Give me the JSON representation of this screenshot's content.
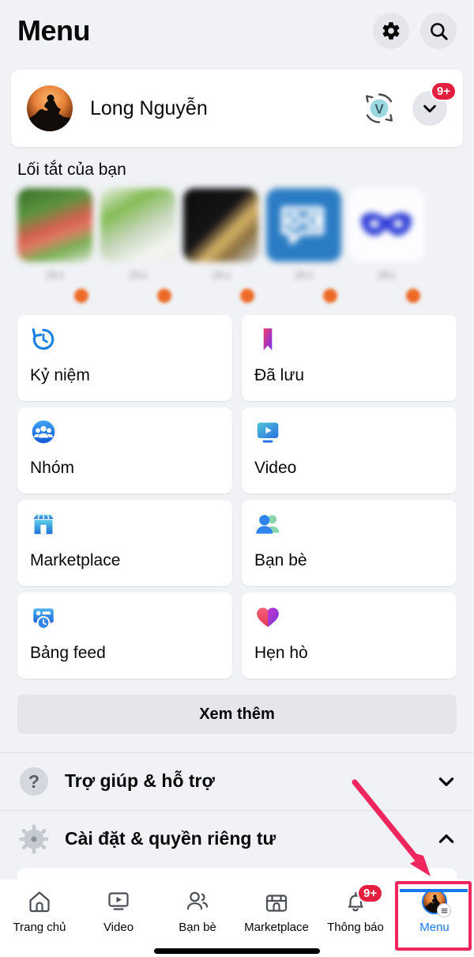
{
  "header": {
    "title": "Menu",
    "settings_icon": "gear-icon",
    "search_icon": "search-icon"
  },
  "profile": {
    "name": "Long Nguyễn",
    "avatar_icon": "user-avatar",
    "switch_account_icon": "avatar-switch-icon",
    "switch_account_letter": "V",
    "expand_icon": "chevron-down-icon",
    "notification_badge": "9+"
  },
  "shortcuts": {
    "title": "Lối tắt của bạn",
    "items": [
      {
        "label": "(ẩn)",
        "thumb": "photo-thumbnail-red-fruit",
        "colors": [
          "#3c6b2a",
          "#d96a5a",
          "#8fbf5f"
        ],
        "badge": "orange-dot-badge"
      },
      {
        "label": "(ẩn)",
        "thumb": "photo-thumbnail-green-plant",
        "colors": [
          "#f2f4f0",
          "#7fb84f",
          "#c9d3c0"
        ],
        "badge": "orange-dot-badge"
      },
      {
        "label": "(ẩn)",
        "thumb": "photo-thumbnail-dark-person",
        "colors": [
          "#141414",
          "#d9b468",
          "#3a3a3a"
        ],
        "badge": "orange-dot-badge"
      },
      {
        "label": "(ẩn)",
        "thumb": "app-icon-blue-page",
        "colors": [
          "#2b7cc4",
          "#2b7cc4",
          "#2b7cc4"
        ],
        "badge": "orange-dot-badge"
      },
      {
        "label": "(ẩn)",
        "thumb": "app-icon-blue-mask",
        "colors": [
          "#ffffff",
          "#2f3ed6",
          "#ffffff"
        ],
        "badge": "orange-dot-badge"
      }
    ]
  },
  "menu_grid": [
    {
      "label": "Kỷ niệm",
      "icon": "memories-clock-icon"
    },
    {
      "label": "Đã lưu",
      "icon": "saved-bookmark-icon"
    },
    {
      "label": "Nhóm",
      "icon": "groups-icon"
    },
    {
      "label": "Video",
      "icon": "video-icon"
    },
    {
      "label": "Marketplace",
      "icon": "marketplace-store-icon"
    },
    {
      "label": "Bạn bè",
      "icon": "friends-icon"
    },
    {
      "label": "Bảng feed",
      "icon": "feeds-icon"
    },
    {
      "label": "Hẹn hò",
      "icon": "dating-heart-icon"
    }
  ],
  "see_more": {
    "label": "Xem thêm"
  },
  "expanders": [
    {
      "label": "Trợ giúp & hỗ trợ",
      "icon": "help-question-icon",
      "chevron": "chevron-down-icon",
      "expanded": "false"
    },
    {
      "label": "Cài đặt & quyền riêng tư",
      "icon": "settings-gear-icon",
      "chevron": "chevron-up-icon",
      "expanded": "true"
    }
  ],
  "bottom_nav": [
    {
      "label": "Trang chủ",
      "icon": "home-icon",
      "active": "false",
      "badge": ""
    },
    {
      "label": "Video",
      "icon": "video-icon",
      "active": "false",
      "badge": ""
    },
    {
      "label": "Bạn bè",
      "icon": "friends-icon",
      "active": "false",
      "badge": ""
    },
    {
      "label": "Marketplace",
      "icon": "marketplace-icon",
      "active": "false",
      "badge": ""
    },
    {
      "label": "Thông báo",
      "icon": "bell-icon",
      "active": "false",
      "badge": "9+"
    },
    {
      "label": "Menu",
      "icon": "menu-avatar-icon",
      "active": "true",
      "badge": ""
    }
  ],
  "annotation": {
    "arrow_icon": "red-arrow-annotation",
    "highlight_icon": "red-highlight-box",
    "color": "#f0275e"
  },
  "colors": {
    "background": "#f0f2f5",
    "card": "#ffffff",
    "accent": "#1877f2",
    "badge_red": "#e41e3f",
    "annotation_pink": "#f0275e",
    "text": "#080809"
  }
}
